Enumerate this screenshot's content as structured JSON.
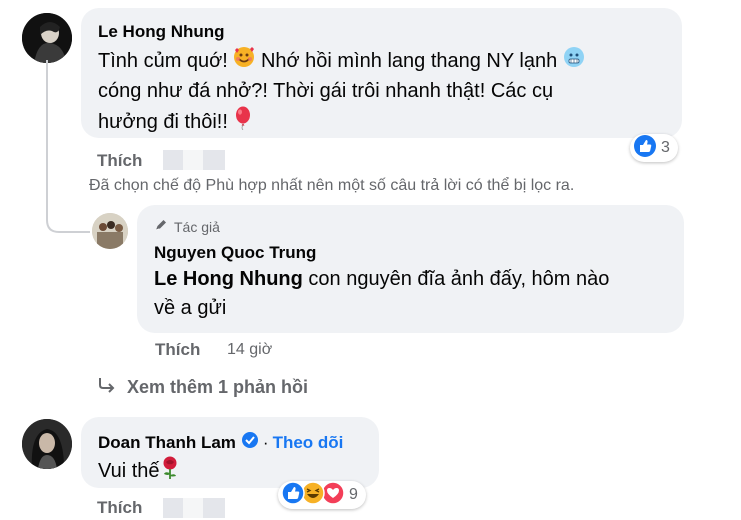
{
  "comment1": {
    "author": "Le Hong Nhung",
    "lines": [
      "Tình củm quớ! ",
      " Nhớ hồi mình lang thang NY lạnh",
      "cóng như đá nhở?! Thời gái trôi nhanh thật! Các cụ",
      "hưởng đi thôi!! "
    ],
    "like_label": "Thích",
    "reaction_count": "3"
  },
  "filter_notice": "Đã chọn chế độ Phù hợp nhất nên một số câu trả lời có thể bị lọc ra.",
  "reply1": {
    "author_badge": "Tác giả",
    "author": "Nguyen Quoc Trung",
    "mention": "Le Hong Nhung",
    "line1": " con nguyên đĩa ảnh đấy, hôm nào",
    "line2": "về a gửi",
    "like_label": "Thích",
    "time": "14 giờ"
  },
  "more_replies": "Xem thêm 1 phản hồi",
  "comment2": {
    "author": "Doan Thanh Lam",
    "follow_label": "Theo dõi",
    "separator": "·",
    "text": "Vui thế",
    "like_label": "Thích",
    "reaction_count": "9"
  },
  "colors": {
    "bubble": "#f0f2f5",
    "link_blue": "#1877f2",
    "secondary_text": "#65676b",
    "like_blue": "#1877f2",
    "love_red": "#f33e58",
    "haha_yellow": "#f7b125"
  },
  "icons": [
    "smiling-face-with-hearts-icon",
    "cold-face-icon",
    "red-balloon-icon",
    "rose-icon",
    "like-reaction-icon",
    "haha-reaction-icon",
    "love-reaction-icon",
    "verified-badge-icon",
    "reply-arrow-icon",
    "author-badge-icon"
  ]
}
